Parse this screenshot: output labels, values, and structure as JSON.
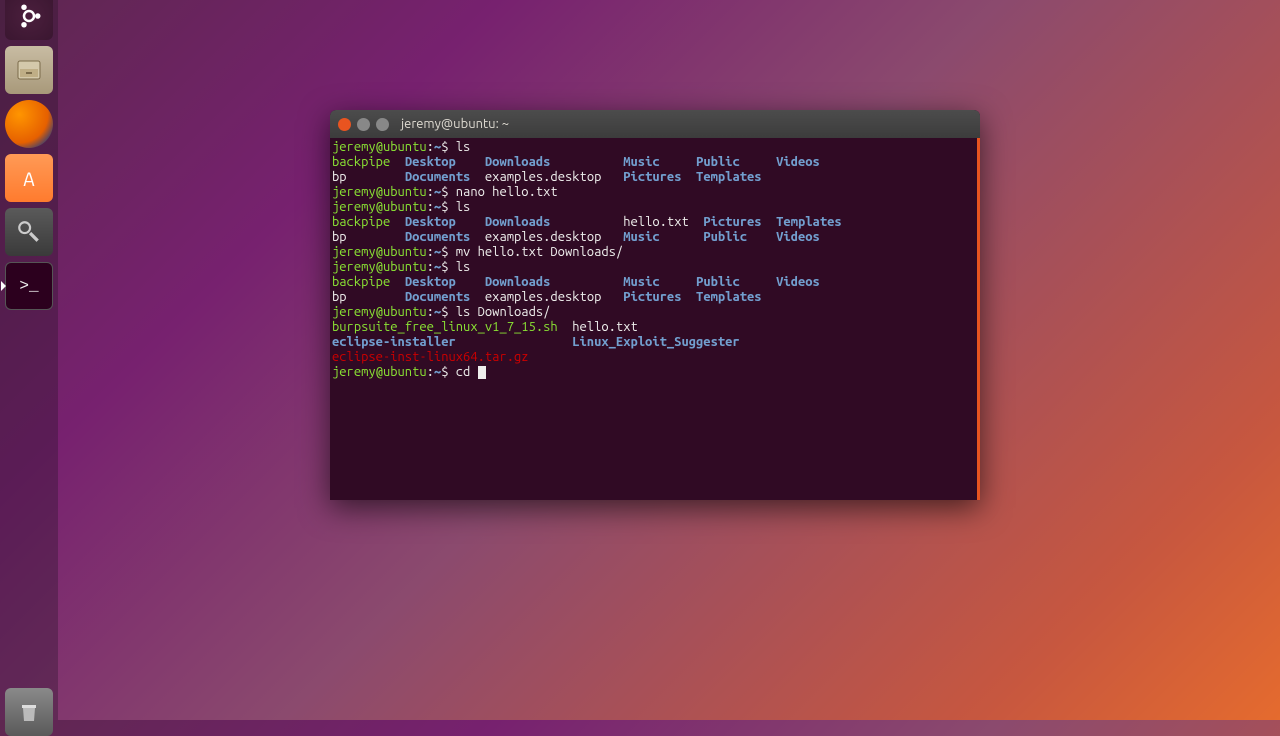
{
  "launcher": {
    "items": [
      {
        "name": "ubuntu-dash",
        "icon": "ubuntu"
      },
      {
        "name": "files",
        "icon": "files"
      },
      {
        "name": "firefox",
        "icon": "firefox"
      },
      {
        "name": "software",
        "icon": "software"
      },
      {
        "name": "settings",
        "icon": "settings"
      },
      {
        "name": "terminal",
        "icon": "terminal"
      },
      {
        "name": "trash",
        "icon": "trash"
      }
    ]
  },
  "window": {
    "title": "jeremy@ubuntu: ~"
  },
  "prompt": {
    "user_host": "jeremy@ubuntu",
    "path": "~",
    "sep": ":",
    "sigil": "$"
  },
  "lines": [
    {
      "type": "cmd",
      "text": "ls"
    },
    {
      "type": "ls",
      "cols": [
        [
          {
            "t": "backpipe",
            "c": "exec"
          },
          {
            "t": "bp",
            "c": ""
          }
        ],
        [
          {
            "t": "Desktop",
            "c": "bblue"
          },
          {
            "t": "Documents",
            "c": "bblue"
          }
        ],
        [
          {
            "t": "Downloads",
            "c": "bblue"
          },
          {
            "t": "examples.desktop",
            "c": ""
          }
        ],
        [
          {
            "t": "Music",
            "c": "bblue"
          },
          {
            "t": "Pictures",
            "c": "bblue"
          }
        ],
        [
          {
            "t": "Public",
            "c": "bblue"
          },
          {
            "t": "Templates",
            "c": "bblue"
          }
        ],
        [
          {
            "t": "Videos",
            "c": "bblue"
          }
        ]
      ],
      "widths": [
        10,
        11,
        19,
        10,
        11,
        8
      ]
    },
    {
      "type": "cmd",
      "text": "nano hello.txt"
    },
    {
      "type": "cmd",
      "text": "ls"
    },
    {
      "type": "ls",
      "cols": [
        [
          {
            "t": "backpipe",
            "c": "exec"
          },
          {
            "t": "bp",
            "c": ""
          }
        ],
        [
          {
            "t": "Desktop",
            "c": "bblue"
          },
          {
            "t": "Documents",
            "c": "bblue"
          }
        ],
        [
          {
            "t": "Downloads",
            "c": "bblue"
          },
          {
            "t": "examples.desktop",
            "c": ""
          }
        ],
        [
          {
            "t": "hello.txt",
            "c": ""
          },
          {
            "t": "Music",
            "c": "bblue"
          }
        ],
        [
          {
            "t": "Pictures",
            "c": "bblue"
          },
          {
            "t": "Public",
            "c": "bblue"
          }
        ],
        [
          {
            "t": "Templates",
            "c": "bblue"
          },
          {
            "t": "Videos",
            "c": "bblue"
          }
        ]
      ],
      "widths": [
        10,
        11,
        19,
        11,
        10,
        10
      ]
    },
    {
      "type": "cmd",
      "text": "mv hello.txt Downloads/"
    },
    {
      "type": "cmd",
      "text": "ls"
    },
    {
      "type": "ls",
      "cols": [
        [
          {
            "t": "backpipe",
            "c": "exec"
          },
          {
            "t": "bp",
            "c": ""
          }
        ],
        [
          {
            "t": "Desktop",
            "c": "bblue"
          },
          {
            "t": "Documents",
            "c": "bblue"
          }
        ],
        [
          {
            "t": "Downloads",
            "c": "bblue"
          },
          {
            "t": "examples.desktop",
            "c": ""
          }
        ],
        [
          {
            "t": "Music",
            "c": "bblue"
          },
          {
            "t": "Pictures",
            "c": "bblue"
          }
        ],
        [
          {
            "t": "Public",
            "c": "bblue"
          },
          {
            "t": "Templates",
            "c": "bblue"
          }
        ],
        [
          {
            "t": "Videos",
            "c": "bblue"
          }
        ]
      ],
      "widths": [
        10,
        11,
        19,
        10,
        11,
        8
      ]
    },
    {
      "type": "cmd",
      "text": "ls Downloads/"
    },
    {
      "type": "ls",
      "cols": [
        [
          {
            "t": "burpsuite_free_linux_v1_7_15.sh",
            "c": "exec"
          },
          {
            "t": "eclipse-installer",
            "c": "bblue"
          },
          {
            "t": "eclipse-inst-linux64.tar.gz",
            "c": "red"
          }
        ],
        [
          {
            "t": "hello.txt",
            "c": ""
          },
          {
            "t": "Linux_Exploit_Suggester",
            "c": "bblue"
          }
        ]
      ],
      "widths": [
        33,
        24
      ]
    },
    {
      "type": "cmd",
      "text": "cd ",
      "cursor": true
    }
  ]
}
